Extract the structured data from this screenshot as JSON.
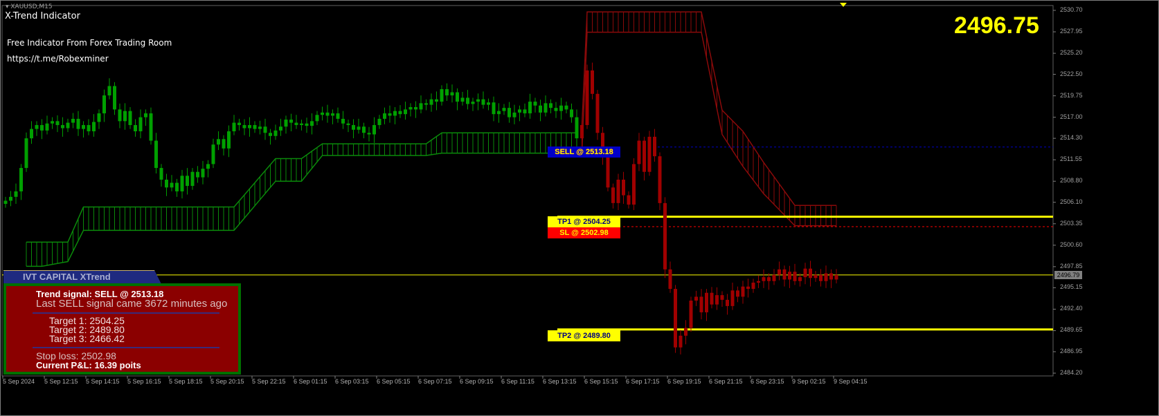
{
  "window": {
    "symbol": "XAUUSD,M15",
    "indicator_name": "X-Trend Indicator",
    "promo_line": "Free Indicator From Forex Trading Room",
    "link": "https://t.me/Robexminer",
    "big_price": "2496.75"
  },
  "labels": {
    "sell": "SELL @ 2513.18",
    "tp1": "TP1 @ 2504.25",
    "sl": "SL @ 2502.98",
    "tp2": "TP2 @ 2489.80",
    "current_price_tag": "2496.79"
  },
  "panel": {
    "title": "IVT CAPITAL XTrend",
    "signal": "Trend signal: SELL @ 2513.18",
    "last_signal": "Last SELL signal came 3672 minutes ago",
    "target1": "Target 1: 2504.25",
    "target2": "Target 2: 2489.80",
    "target3": "Target 3: 2466.42",
    "stop_loss": "Stop loss: 2502.98",
    "pnl": "Current P&L: 16.39 poits"
  },
  "colors": {
    "bull_trend": "#00a000",
    "bear_trend": "#a00000",
    "band_green": "#0a8a0a",
    "band_red": "#8b0a0a",
    "target_line": "#ffff00",
    "sell_line": "#0000c8",
    "sl_line": "#ff0000"
  },
  "chart_data": {
    "type": "candlestick",
    "title": "XAUUSD,M15",
    "ylim": [
      2484.2,
      2530.7
    ],
    "y_ticks": [
      "2530.70",
      "2527.95",
      "2525.20",
      "2522.50",
      "2519.75",
      "2517.00",
      "2514.30",
      "2511.55",
      "2508.80",
      "2506.10",
      "2503.35",
      "2500.60",
      "2497.85",
      "2495.15",
      "2492.40",
      "2489.65",
      "2486.95",
      "2484.20"
    ],
    "x_ticks": [
      "5 Sep 2024",
      "5 Sep 12:15",
      "5 Sep 14:15",
      "5 Sep 16:15",
      "5 Sep 18:15",
      "5 Sep 20:15",
      "5 Sep 22:15",
      "6 Sep 01:15",
      "6 Sep 03:15",
      "6 Sep 05:15",
      "6 Sep 07:15",
      "6 Sep 09:15",
      "6 Sep 11:15",
      "6 Sep 13:15",
      "6 Sep 15:15",
      "6 Sep 17:15",
      "6 Sep 19:15",
      "6 Sep 21:15",
      "6 Sep 23:15",
      "9 Sep 02:15",
      "9 Sep 04:15"
    ],
    "trend_switch_index": 111,
    "closes": [
      2506.3,
      2506.8,
      2507.5,
      2510.5,
      2514.3,
      2515.5,
      2516.0,
      2515.3,
      2516.2,
      2516.5,
      2516.0,
      2515.6,
      2516.3,
      2516.8,
      2515.5,
      2516.0,
      2515.2,
      2516.4,
      2517.5,
      2519.8,
      2521.0,
      2518.0,
      2516.5,
      2517.8,
      2516.0,
      2515.2,
      2517.0,
      2517.5,
      2514.0,
      2510.5,
      2509.0,
      2508.0,
      2508.6,
      2507.5,
      2509.5,
      2508.2,
      2510.0,
      2509.3,
      2510.4,
      2511.0,
      2513.5,
      2514.2,
      2513.0,
      2515.2,
      2516.3,
      2516.0,
      2515.6,
      2516.0,
      2515.5,
      2515.8,
      2515.0,
      2514.6,
      2515.3,
      2515.8,
      2516.7,
      2516.3,
      2516.0,
      2516.2,
      2515.9,
      2516.5,
      2517.3,
      2517.6,
      2517.2,
      2517.5,
      2516.8,
      2516.2,
      2516.0,
      2515.4,
      2515.8,
      2515.0,
      2514.8,
      2516.0,
      2516.8,
      2517.5,
      2517.2,
      2517.8,
      2517.4,
      2518.0,
      2518.3,
      2518.0,
      2518.8,
      2518.6,
      2519.3,
      2519.0,
      2520.6,
      2519.8,
      2520.2,
      2519.0,
      2519.5,
      2518.7,
      2519.0,
      2519.3,
      2518.6,
      2518.9,
      2517.4,
      2517.8,
      2518.2,
      2517.0,
      2517.6,
      2518.0,
      2517.5,
      2519.0,
      2518.5,
      2517.6,
      2518.8,
      2518.2,
      2517.8,
      2518.5,
      2518.0,
      2517.0,
      2514.3,
      2516.0,
      2523.0,
      2520.0,
      2515.0,
      2512.0,
      2508.0,
      2506.0,
      2509.0,
      2507.0,
      2505.8,
      2511.0,
      2514.0,
      2510.0,
      2514.5,
      2512.0,
      2506.0,
      2497.5,
      2495.0,
      2487.5,
      2489.0,
      2490.0,
      2493.5,
      2494.0,
      2492.0,
      2494.5,
      2493.0,
      2494.2,
      2493.6,
      2492.8,
      2494.8,
      2494.0,
      2495.3,
      2495.0,
      2495.8,
      2496.0,
      2496.5,
      2496.0,
      2496.8,
      2497.5,
      2496.2,
      2497.2,
      2496.0,
      2496.5,
      2497.6,
      2496.4,
      2496.8,
      2496.0,
      2497.0,
      2496.2,
      2496.79
    ],
    "band_green": [
      [
        4,
        2501.0,
        2497.9
      ],
      [
        7,
        2501.0,
        2497.9
      ],
      [
        12,
        2501.0,
        2498.5
      ],
      [
        15,
        2505.5,
        2502.5
      ],
      [
        44,
        2505.5,
        2502.5
      ],
      [
        52,
        2511.7,
        2508.8
      ],
      [
        57,
        2511.7,
        2508.8
      ],
      [
        61,
        2513.6,
        2512.1
      ],
      [
        81,
        2513.6,
        2512.1
      ],
      [
        84,
        2515.0,
        2512.4
      ],
      [
        110,
        2515.0,
        2512.4
      ]
    ],
    "band_red": [
      [
        111,
        2516.0,
        2512.6
      ],
      [
        112,
        2530.5,
        2527.9
      ],
      [
        134,
        2530.5,
        2527.9
      ],
      [
        138,
        2517.9,
        2514.8
      ],
      [
        142,
        2515.2,
        2510.7
      ],
      [
        146,
        2511.2,
        2507.2
      ],
      [
        152,
        2505.7,
        2503.1
      ],
      [
        160,
        2505.7,
        2503.1
      ]
    ],
    "levels": {
      "sell": 2513.18,
      "tp1": 2504.25,
      "sl": 2502.98,
      "current": 2496.79,
      "tp2": 2489.8
    }
  }
}
